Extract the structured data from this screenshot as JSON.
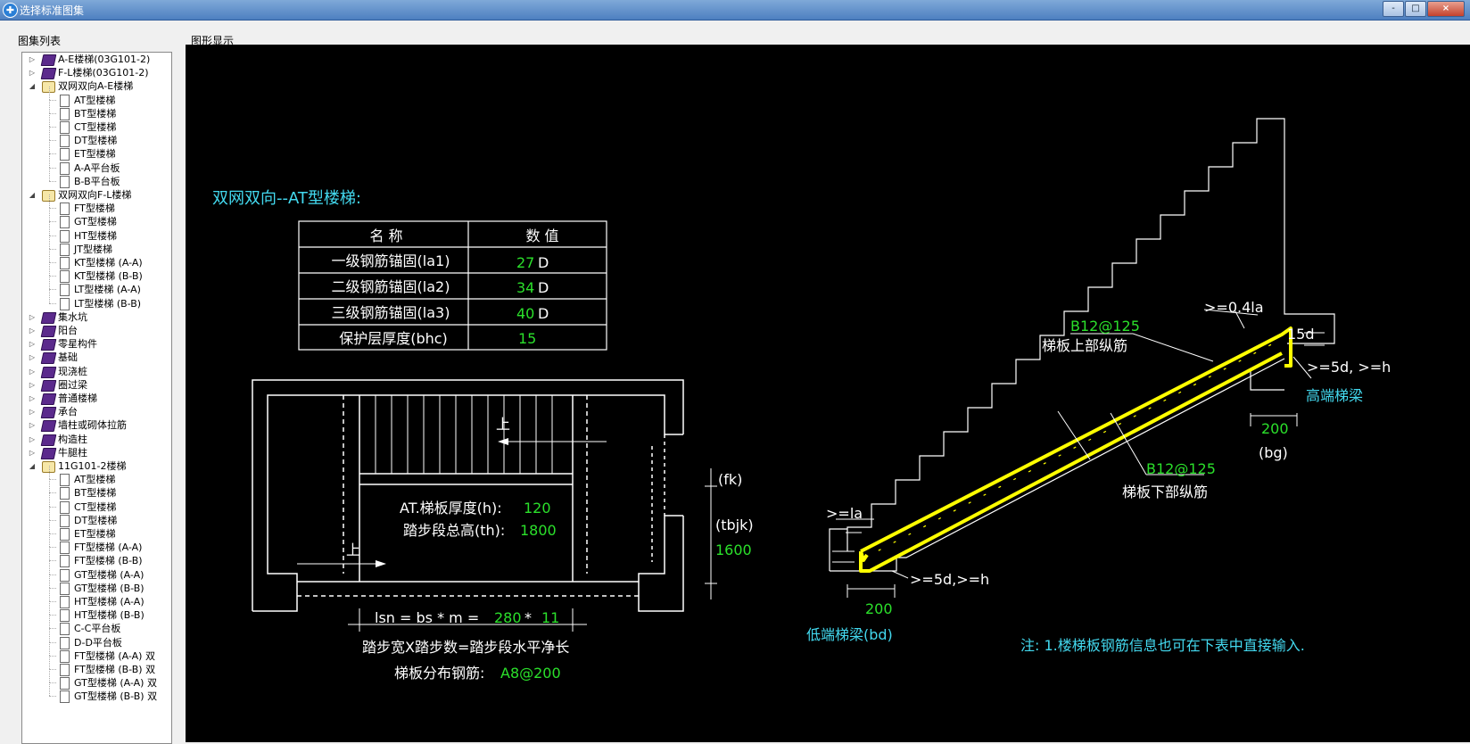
{
  "window": {
    "title": "选择标准图集",
    "minimize": "-",
    "restore": "□",
    "close": "×"
  },
  "panels": {
    "tree_label": "图集列表",
    "view_label": "图形显示"
  },
  "tree": [
    {
      "label": "A-E楼梯(03G101-2)",
      "level": 0,
      "icon": "book",
      "toggle": "▷"
    },
    {
      "label": "F-L楼梯(03G101-2)",
      "level": 0,
      "icon": "book",
      "toggle": "▷"
    },
    {
      "label": "双网双向A-E楼梯",
      "level": 0,
      "icon": "open",
      "toggle": "◢"
    },
    {
      "label": "AT型楼梯",
      "level": 1,
      "icon": "page"
    },
    {
      "label": "BT型楼梯",
      "level": 1,
      "icon": "page"
    },
    {
      "label": "CT型楼梯",
      "level": 1,
      "icon": "page"
    },
    {
      "label": "DT型楼梯",
      "level": 1,
      "icon": "page"
    },
    {
      "label": "ET型楼梯",
      "level": 1,
      "icon": "page"
    },
    {
      "label": "A-A平台板",
      "level": 1,
      "icon": "page"
    },
    {
      "label": "B-B平台板",
      "level": 1,
      "icon": "page"
    },
    {
      "label": "双网双向F-L楼梯",
      "level": 0,
      "icon": "open",
      "toggle": "◢"
    },
    {
      "label": "FT型楼梯",
      "level": 1,
      "icon": "page"
    },
    {
      "label": "GT型楼梯",
      "level": 1,
      "icon": "page"
    },
    {
      "label": "HT型楼梯",
      "level": 1,
      "icon": "page"
    },
    {
      "label": "JT型楼梯",
      "level": 1,
      "icon": "page"
    },
    {
      "label": "KT型楼梯 (A-A)",
      "level": 1,
      "icon": "page"
    },
    {
      "label": "KT型楼梯 (B-B)",
      "level": 1,
      "icon": "page"
    },
    {
      "label": "LT型楼梯 (A-A)",
      "level": 1,
      "icon": "page"
    },
    {
      "label": "LT型楼梯 (B-B)",
      "level": 1,
      "icon": "page"
    },
    {
      "label": "集水坑",
      "level": 0,
      "icon": "book",
      "toggle": "▷"
    },
    {
      "label": "阳台",
      "level": 0,
      "icon": "book",
      "toggle": "▷"
    },
    {
      "label": "零星构件",
      "level": 0,
      "icon": "book",
      "toggle": "▷"
    },
    {
      "label": "基础",
      "level": 0,
      "icon": "book",
      "toggle": "▷"
    },
    {
      "label": "现浇桩",
      "level": 0,
      "icon": "book",
      "toggle": "▷"
    },
    {
      "label": "圈过梁",
      "level": 0,
      "icon": "book",
      "toggle": "▷"
    },
    {
      "label": "普通楼梯",
      "level": 0,
      "icon": "book",
      "toggle": "▷"
    },
    {
      "label": "承台",
      "level": 0,
      "icon": "book",
      "toggle": "▷"
    },
    {
      "label": "墙柱或砌体拉筋",
      "level": 0,
      "icon": "book",
      "toggle": "▷"
    },
    {
      "label": "构造柱",
      "level": 0,
      "icon": "book",
      "toggle": "▷"
    },
    {
      "label": "牛腿柱",
      "level": 0,
      "icon": "book",
      "toggle": "▷"
    },
    {
      "label": "11G101-2楼梯",
      "level": 0,
      "icon": "open",
      "toggle": "◢"
    },
    {
      "label": "AT型楼梯",
      "level": 1,
      "icon": "page"
    },
    {
      "label": "BT型楼梯",
      "level": 1,
      "icon": "page"
    },
    {
      "label": "CT型楼梯",
      "level": 1,
      "icon": "page"
    },
    {
      "label": "DT型楼梯",
      "level": 1,
      "icon": "page"
    },
    {
      "label": "ET型楼梯",
      "level": 1,
      "icon": "page"
    },
    {
      "label": "FT型楼梯 (A-A)",
      "level": 1,
      "icon": "page"
    },
    {
      "label": "FT型楼梯 (B-B)",
      "level": 1,
      "icon": "page"
    },
    {
      "label": "GT型楼梯 (A-A)",
      "level": 1,
      "icon": "page"
    },
    {
      "label": "GT型楼梯 (B-B)",
      "level": 1,
      "icon": "page"
    },
    {
      "label": "HT型楼梯 (A-A)",
      "level": 1,
      "icon": "page"
    },
    {
      "label": "HT型楼梯 (B-B)",
      "level": 1,
      "icon": "page"
    },
    {
      "label": "C-C平台板",
      "level": 1,
      "icon": "page"
    },
    {
      "label": "D-D平台板",
      "level": 1,
      "icon": "page"
    },
    {
      "label": "FT型楼梯 (A-A) 双",
      "level": 1,
      "icon": "page"
    },
    {
      "label": "FT型楼梯 (B-B) 双",
      "level": 1,
      "icon": "page"
    },
    {
      "label": "GT型楼梯 (A-A) 双",
      "level": 1,
      "icon": "page"
    },
    {
      "label": "GT型楼梯 (B-B) 双",
      "level": 1,
      "icon": "page"
    }
  ],
  "drawing": {
    "title": "双网双向--AT型楼梯:",
    "table": {
      "headers": [
        "名 称",
        "数 值"
      ],
      "rows": [
        {
          "name": "一级钢筋锚固(la1)",
          "value": "27",
          "unit": "D"
        },
        {
          "name": "二级钢筋锚固(la2)",
          "value": "34",
          "unit": "D"
        },
        {
          "name": "三级钢筋锚固(la3)",
          "value": "40",
          "unit": "D"
        },
        {
          "name": "保护层厚度(bhc)",
          "value": "15",
          "unit": ""
        }
      ]
    },
    "plan": {
      "up1": "上",
      "up2": "上",
      "thickness_label": "AT.梯板厚度(h):",
      "thickness_value": "120",
      "height_label": "踏步段总高(th):",
      "height_value": "1800",
      "fk": "(fk)",
      "tbjk": "(tbjk)",
      "width_value": "1600",
      "lsn_label": "lsn = bs * m =",
      "bs": "280",
      "star": "*",
      "m": "11",
      "caption1": "踏步宽X踏步数=踏步段水平净长",
      "caption2_label": "梯板分布钢筋:",
      "caption2_value": "A8@200"
    },
    "section": {
      "top_rebar": "B12@125",
      "top_label": "梯板上部纵筋",
      "bottom_rebar": "B12@125",
      "bottom_label": "梯板下部纵筋",
      "anchor_top": ">=0.4la",
      "d15": "15d",
      "hook_right": ">=5d, >=h",
      "high_beam": "高端梯梁",
      "bg_value": "200",
      "bg": "(bg)",
      "la_low": ">=la",
      "hook_low": ">=5d,>=h",
      "bd_value": "200",
      "low_beam": "低端梯梁(bd)"
    },
    "note": "注: 1.楼梯板钢筋信息也可在下表中直接输入."
  }
}
